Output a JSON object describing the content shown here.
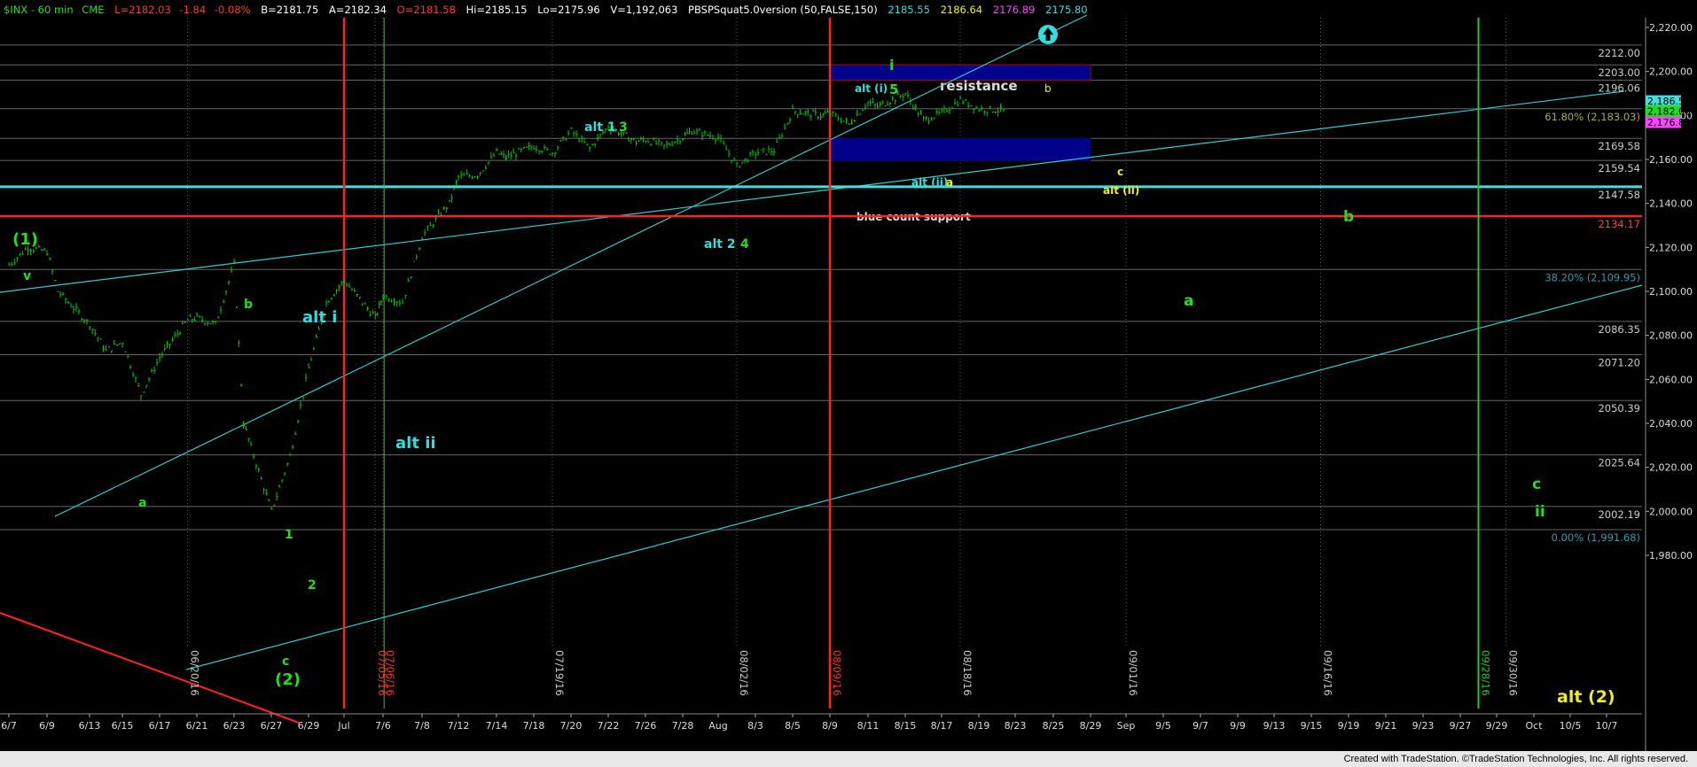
{
  "header": {
    "symbol": "$INX - 60 min",
    "exchange": "CME",
    "last": "L=2182.03",
    "change": "-1.84",
    "change_pct": "-0.08%",
    "bid": "B=2181.75",
    "ask": "A=2182.34",
    "open": "O=2181.58",
    "high": "Hi=2185.15",
    "low": "Lo=2175.96",
    "volume": "V=1,192,063",
    "study": "PBSPSquat5.0version (50,FALSE,150)",
    "study_values": [
      "2185.55",
      "2186.64",
      "2176.89",
      "2175.80"
    ]
  },
  "footer": {
    "credit": "Created with TradeStation. ©TradeStation Technologies, Inc. All rights reserved."
  },
  "colors": {
    "background": "#000000",
    "grid": "#666666",
    "bars": "#00cc00",
    "channel": "#33cccc",
    "red_lines": "#ff2222",
    "box": "#00008b",
    "wave_green": "#22dd22",
    "wave_cyan": "#33dddd",
    "wave_yellow": "#eeee22"
  },
  "chart_data": {
    "type": "bar",
    "title": "$INX - 60 min",
    "y_range": [
      1975,
      2225
    ],
    "y_ticks": [
      "2,220.00",
      "2,200.00",
      "2,180.00",
      "2,160.00",
      "2,140.00",
      "2,120.00",
      "2,100.00",
      "2,080.00",
      "2,060.00",
      "2,040.00",
      "2,020.00",
      "2,000.00",
      "1,980.00"
    ],
    "y_tick_values": [
      2220,
      2200,
      2180,
      2160,
      2140,
      2120,
      2100,
      2080,
      2060,
      2040,
      2020,
      2000,
      1980
    ],
    "x_dates": [
      "6/7",
      "6/9",
      "6/13",
      "6/15",
      "6/17",
      "6/21",
      "6/23",
      "6/27",
      "6/29",
      "Jul",
      "7/6",
      "7/8",
      "7/12",
      "7/14",
      "7/18",
      "7/20",
      "7/22",
      "7/26",
      "7/28",
      "Aug",
      "8/3",
      "8/5",
      "8/9",
      "8/11",
      "8/15",
      "8/17",
      "8/19",
      "8/23",
      "8/25",
      "8/29",
      "Sep",
      "9/5",
      "9/7",
      "9/9",
      "9/13",
      "9/15",
      "9/19",
      "9/21",
      "9/23",
      "9/27",
      "9/29",
      "Oct",
      "10/5",
      "10/7"
    ],
    "rotated_dates": [
      "06/20/16",
      "07/05/16",
      "07/06/16",
      "07/19/16",
      "08/02/16",
      "08/09/16",
      "08/18/16",
      "09/01/16",
      "09/16/16",
      "09/28/16",
      "09/30/16"
    ],
    "price_levels": [
      {
        "label": "2212.00",
        "value": 2212.0
      },
      {
        "label": "2203.00",
        "value": 2203.0
      },
      {
        "label": "2196.06",
        "value": 2196.06
      },
      {
        "label": "61.80% (2,183.03)",
        "value": 2183.03
      },
      {
        "label": "2169.58",
        "value": 2169.58
      },
      {
        "label": "2159.54",
        "value": 2159.54
      },
      {
        "label": "2147.58",
        "value": 2147.58
      },
      {
        "label": "2134.17",
        "value": 2134.17
      },
      {
        "label": "38.20% (2,109.95)",
        "value": 2109.95
      },
      {
        "label": "2086.35",
        "value": 2086.35
      },
      {
        "label": "2071.20",
        "value": 2071.2
      },
      {
        "label": "2050.39",
        "value": 2050.39
      },
      {
        "label": "2025.64",
        "value": 2025.64
      },
      {
        "label": "2002.19",
        "value": 2002.19
      },
      {
        "label": "0.00% (1,991.68)",
        "value": 1991.68
      }
    ],
    "current_price_tags": [
      {
        "label": "2,186.55",
        "value": 2186.55
      },
      {
        "label": "2,182.03",
        "value": 2182.03
      },
      {
        "label": "2,176.89",
        "value": 2176.89
      }
    ],
    "boxes": [
      {
        "name": "resistance",
        "from": "8/9",
        "to": "8/29",
        "low": 2196.06,
        "high": 2203.0
      },
      {
        "name": "blue count support",
        "from": "8/9",
        "to": "8/29",
        "low": 2159.54,
        "high": 2169.58
      }
    ],
    "box_labels": {
      "resistance": "resistance",
      "support": "blue count support"
    },
    "wave_labels": [
      "(1)",
      "v",
      "a",
      "b",
      "alt i",
      "c",
      "(2)",
      "1",
      "2",
      "alt ii",
      "alt 1",
      "3",
      "alt 2",
      "4",
      "i",
      "alt (i)",
      "5",
      "b",
      "alt (ii)",
      "a",
      "c",
      "alt (ii)",
      "b",
      "a",
      "c",
      "ii",
      "alt (2)"
    ],
    "price_path": [
      {
        "x": "6/7",
        "y": 2112
      },
      {
        "x": "6/8",
        "y": 2120
      },
      {
        "x": "6/9",
        "y": 2118
      },
      {
        "x": "6/10",
        "y": 2100
      },
      {
        "x": "6/13",
        "y": 2085
      },
      {
        "x": "6/14",
        "y": 2073
      },
      {
        "x": "6/15",
        "y": 2077
      },
      {
        "x": "6/16",
        "y": 2053
      },
      {
        "x": "6/17",
        "y": 2070
      },
      {
        "x": "6/20",
        "y": 2087
      },
      {
        "x": "6/21",
        "y": 2088
      },
      {
        "x": "6/22",
        "y": 2085
      },
      {
        "x": "6/23",
        "y": 2112
      },
      {
        "x": "6/24",
        "y": 2040
      },
      {
        "x": "6/27",
        "y": 2000
      },
      {
        "x": "6/28",
        "y": 2025
      },
      {
        "x": "6/29",
        "y": 2065
      },
      {
        "x": "6/30",
        "y": 2095
      },
      {
        "x": "7/1",
        "y": 2105
      },
      {
        "x": "7/5",
        "y": 2088
      },
      {
        "x": "7/6",
        "y": 2098
      },
      {
        "x": "7/7",
        "y": 2095
      },
      {
        "x": "7/8",
        "y": 2125
      },
      {
        "x": "7/11",
        "y": 2140
      },
      {
        "x": "7/12",
        "y": 2152
      },
      {
        "x": "7/13",
        "y": 2153
      },
      {
        "x": "7/14",
        "y": 2163
      },
      {
        "x": "7/15",
        "y": 2161
      },
      {
        "x": "7/18",
        "y": 2166
      },
      {
        "x": "7/19",
        "y": 2163
      },
      {
        "x": "7/20",
        "y": 2173
      },
      {
        "x": "7/21",
        "y": 2165
      },
      {
        "x": "7/22",
        "y": 2175
      },
      {
        "x": "7/25",
        "y": 2168
      },
      {
        "x": "7/26",
        "y": 2169
      },
      {
        "x": "7/27",
        "y": 2166
      },
      {
        "x": "7/28",
        "y": 2170
      },
      {
        "x": "7/29",
        "y": 2173
      },
      {
        "x": "8/1",
        "y": 2170
      },
      {
        "x": "8/2",
        "y": 2157
      },
      {
        "x": "8/3",
        "y": 2163
      },
      {
        "x": "8/4",
        "y": 2164
      },
      {
        "x": "8/5",
        "y": 2182
      },
      {
        "x": "8/8",
        "y": 2180
      },
      {
        "x": "8/9",
        "y": 2181
      },
      {
        "x": "8/10",
        "y": 2176
      },
      {
        "x": "8/11",
        "y": 2186
      },
      {
        "x": "8/12",
        "y": 2184
      },
      {
        "x": "8/15",
        "y": 2190
      },
      {
        "x": "8/16",
        "y": 2178
      },
      {
        "x": "8/17",
        "y": 2181
      },
      {
        "x": "8/18",
        "y": 2187
      },
      {
        "x": "8/19",
        "y": 2183
      },
      {
        "x": "8/22",
        "y": 2182
      }
    ]
  }
}
